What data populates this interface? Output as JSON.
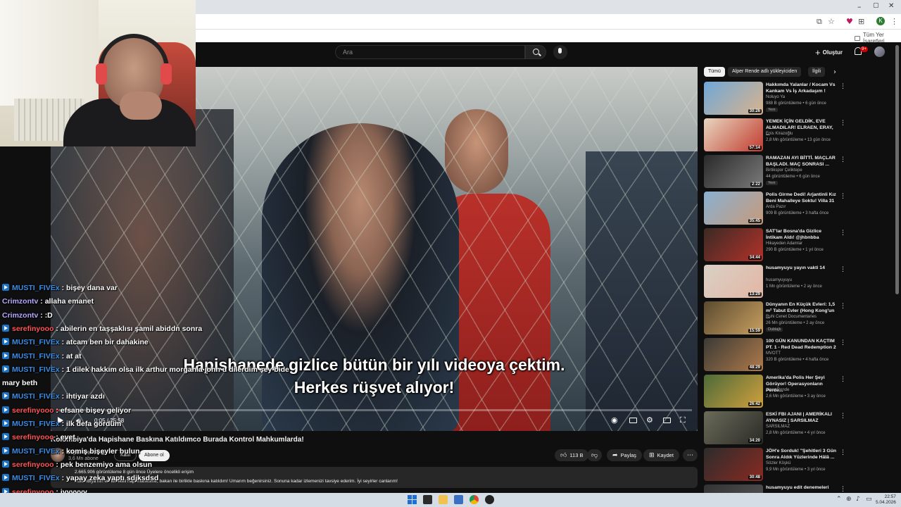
{
  "browser": {
    "window_controls": [
      "–",
      "▢",
      "✕"
    ],
    "bookmark_folder": "Tüm Yer İşaretleri",
    "profile_letter": "K"
  },
  "header": {
    "search_placeholder": "Ara",
    "create_label": "Oluştur",
    "notification_count": "9+"
  },
  "video": {
    "subtitle_line1": "Hapishanede gizlice bütün bir yılı videoya çektim.",
    "subtitle_line2": "Herkes rüşvet alıyor!",
    "timecode": "0:05 / 25:58",
    "progress_fraction": 0.003
  },
  "watch": {
    "title": "Kolombiya'da Hapishane Baskına Katıldımco Burada Kontrol Mahkumlarda!",
    "channel": "Alper Rende",
    "subscribers": "3,6 Mn abone",
    "join_label": "Katıl",
    "subscribe_label": "Abone ol",
    "like_count": "113 B",
    "share_label": "Paylaş",
    "save_label": "Kaydet",
    "description_meta": "2.665.906 görüntüleme  8 gün önce  Üyelere öncelikli erişim",
    "description_text": "Kolombiya'nın en tehlikeli hapishanesine, bakan ile birlikte baskına katıldım! Umarım beğenirsiniz. Sonuna kadar izlemenizi tavsiye ederim. İyi seyirler canlarım!"
  },
  "sidebar": {
    "chips": [
      "Tümü",
      "Alper Rende adlı yükleyiciden",
      "İlgili"
    ],
    "recommendations": [
      {
        "title": "Hakkımda Yalanlar / Kocam Vs Kankam Vs İş Arkadaşım !",
        "channel": "Noluyo Ya",
        "meta": "988 B görüntüleme • 6 gün önce",
        "badge": "Yeni",
        "duration": "30:26",
        "c1": "#6fa8d8",
        "c2": "#d9b38c"
      },
      {
        "title": "YEMEK İÇİN GELDİK, EVE ALMADILAR! ELRAEN, ERAY, ...",
        "channel": "Enis Kirazoğlu",
        "meta": "2,8 Mn görüntüleme • 13 gün önce",
        "badge": "",
        "duration": "57:14",
        "c1": "#e8d7c0",
        "c2": "#c23b2f"
      },
      {
        "title": "RAMAZAN AYI BİTTİ. MAÇLAR BAŞLADI. MAÇ SONRASI ...",
        "channel": "Birtikspor Çeliktepe",
        "meta": "44 görüntüleme • 6 gün önce",
        "badge": "Yeni",
        "duration": "2:22",
        "c1": "#2a2a2a",
        "c2": "#7a7a7a"
      },
      {
        "title": "Polis Girme Dedi! Arjantinli Kız Beni Mahalleye Soktu! Villa 31",
        "channel": "Arda Pazır",
        "meta": "909 B görüntüleme • 3 hafta önce",
        "badge": "",
        "duration": "35:45",
        "c1": "#8ab0d0",
        "c2": "#c69a7b"
      },
      {
        "title": "SAT'lar Bosna'da Gizlice İntikam Aldı! @jhbnbba",
        "channel": "Hikayeden Adamlar",
        "meta": "290 B görüntüleme • 1 yıl önce",
        "badge": "",
        "duration": "34:44",
        "c1": "#3a2a24",
        "c2": "#b3322a"
      },
      {
        "title": "husamyuyu yayın vakti 14",
        "channel": "husamyuyuyu",
        "meta": "1 Mn görüntüleme • 2 ay önce",
        "badge": "",
        "duration": "13:29",
        "c1": "#d9d0c5",
        "c2": "#e3b6a4"
      },
      {
        "title": "Dünyanın En Küçük Evleri: 1,5 m² Tabut Evler (Hong Kong'un ...",
        "channel": "Ruhi Cenet Documentaries",
        "meta": "26 Mn görüntüleme • 2 ay önce",
        "badge": "Dublajlı",
        "duration": "15:59",
        "c1": "#5a4a30",
        "c2": "#c9a060"
      },
      {
        "title": "100 GÜN KANUNDAN KAÇTIM PT. 1 - Red Dead Redemption 2",
        "channel": "MVOTT",
        "meta": "320 B görüntüleme • 4 hafta önce",
        "badge": "",
        "duration": "48:29",
        "c1": "#3b3a36",
        "c2": "#b07a4a"
      },
      {
        "title": "Amerika'da Polis Her Şeyi Görüyor! Operasyonların Perde...",
        "channel": "Alper Rende",
        "meta": "2,6 Mn görüntüleme • 3 ay önce",
        "badge": "",
        "duration": "26:42",
        "c1": "#4d6a3a",
        "c2": "#d1a03c"
      },
      {
        "title": "ESKİ FBI AJANI | AMERİKALI AYNASIZ | SARSILMAZ",
        "channel": "SARSILMAZ",
        "meta": "2,8 Mn görüntüleme • 4 yıl önce",
        "badge": "",
        "duration": "34:20",
        "c1": "#6b6b5a",
        "c2": "#2a2a26"
      },
      {
        "title": "JÖH'e Sorduk! \"Şehitleri 3 Gün Sonra Aldık Yüzlerinde Hâlâ ...",
        "channel": "Sözler Köşkü",
        "meta": "9,9 Mn görüntüleme • 3 yıl önce",
        "badge": "",
        "duration": "30:48",
        "c1": "#2c2c2c",
        "c2": "#8a2a22"
      },
      {
        "title": "husamyuyu edit denemeleri",
        "channel": "",
        "meta": "",
        "badge": "",
        "duration": "",
        "c1": "#333",
        "c2": "#555"
      }
    ]
  },
  "chat": [
    {
      "user": "MUSTI_FIVEx",
      "color": "#3a8ee6",
      "icon": true,
      "text": "bişey dana var"
    },
    {
      "user": "Crimzontv",
      "color": "#b9a8ff",
      "icon": false,
      "text": "allaha emanet"
    },
    {
      "user": "Crimzontv",
      "color": "#b9a8ff",
      "icon": false,
      "text": ":D"
    },
    {
      "user": "serefinyooo",
      "color": "#ff5757",
      "icon": true,
      "text": "abilerin en taşşaklısı şamil abiddn sonra"
    },
    {
      "user": "MUSTI_FIVEx",
      "color": "#3a8ee6",
      "icon": true,
      "text": "atcam ben bir dahakine"
    },
    {
      "user": "MUSTI_FIVEx",
      "color": "#3a8ee6",
      "icon": true,
      "text": "at at"
    },
    {
      "user": "MUSTI_FIVEx",
      "color": "#3a8ee6",
      "icon": true,
      "text": "1 dilek hakkım olsa ilk arthur morganla john u dilerdim şey bide"
    },
    {
      "user": "",
      "color": "#fff",
      "icon": false,
      "text": "mary beth"
    },
    {
      "user": "MUSTI_FIVEx",
      "color": "#3a8ee6",
      "icon": true,
      "text": "ihtiyar azdı"
    },
    {
      "user": "serefinyooo",
      "color": "#ff5757",
      "icon": true,
      "text": "efsane bişey geliyor"
    },
    {
      "user": "MUSTI_FIVEx",
      "color": "#3a8ee6",
      "icon": true,
      "text": "ilk defa gördüm"
    },
    {
      "user": "serefinyooo",
      "color": "#ff5757",
      "icon": true,
      "text": "evet"
    },
    {
      "user": "MUSTI_FIVEx",
      "color": "#3a8ee6",
      "icon": true,
      "text": "komiş bişeyler bulun"
    },
    {
      "user": "serefinyooo",
      "color": "#ff5757",
      "icon": true,
      "text": "pek benzemiyo ama olsun"
    },
    {
      "user": "MUSTI_FIVEx",
      "color": "#3a8ee6",
      "icon": true,
      "text": "yapay zeka yaptı sdjksdsd"
    },
    {
      "user": "serefinyooo",
      "color": "#ff5757",
      "icon": true,
      "text": "iyyyyyy"
    }
  ],
  "taskbar": {
    "time": "22:57",
    "date": "5.04.2026"
  }
}
